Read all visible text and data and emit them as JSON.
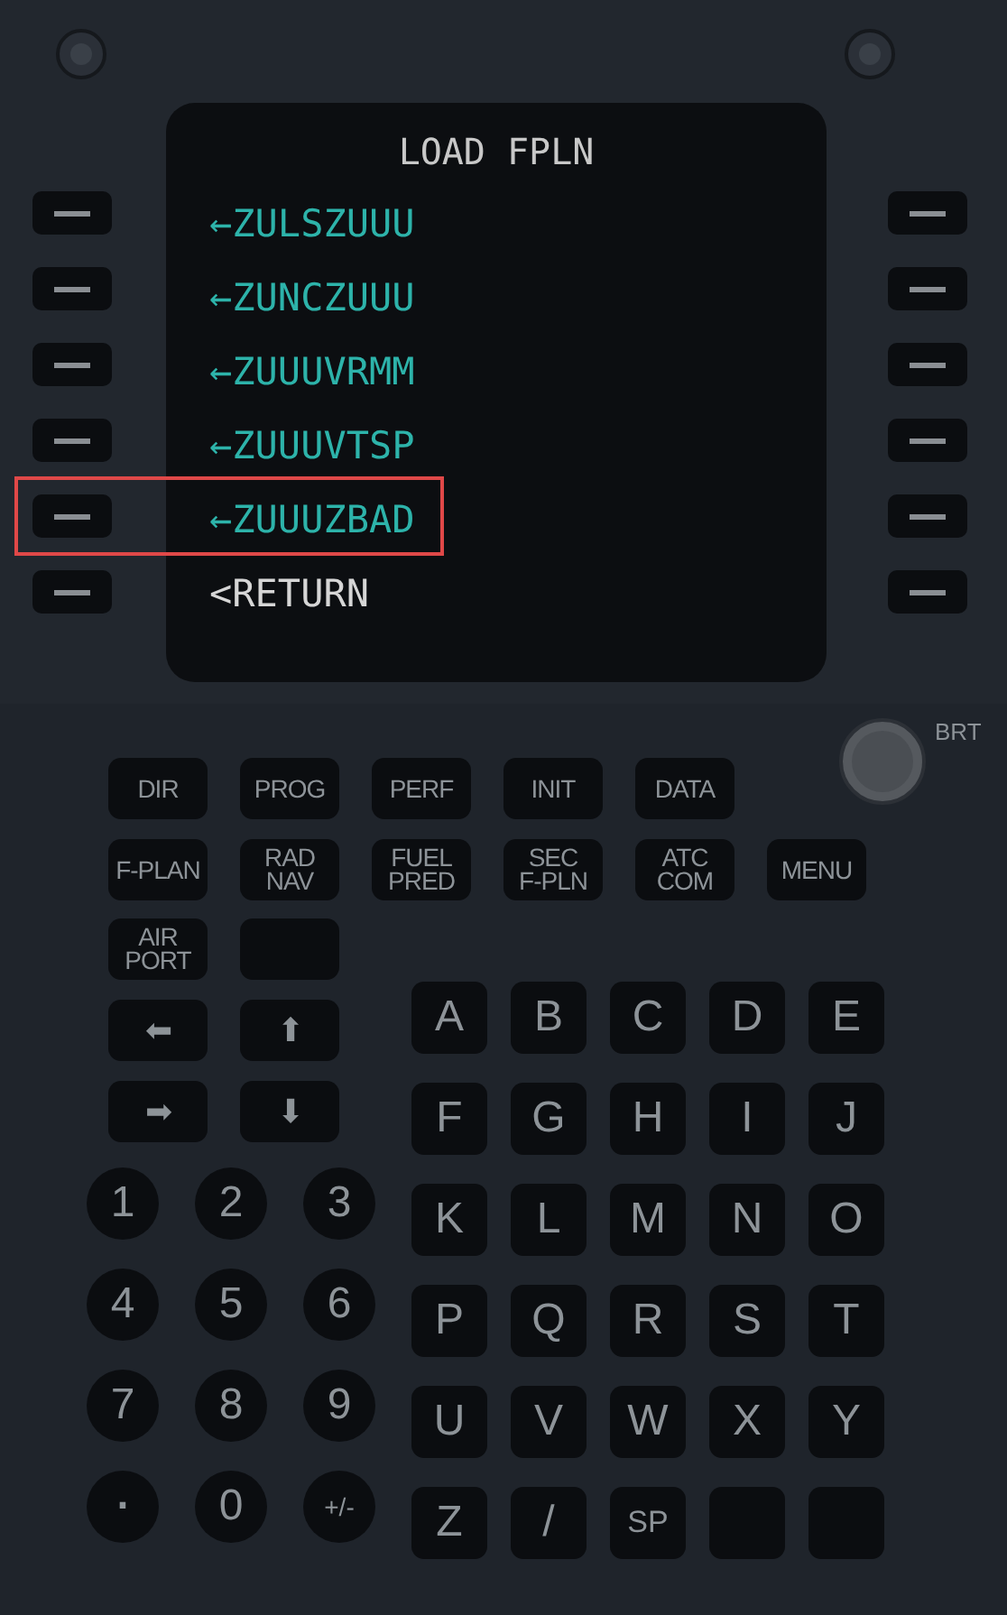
{
  "screen": {
    "title": "LOAD FPLN",
    "lines": [
      {
        "text": "←ZULSZUUU",
        "color": "#2db3aa",
        "highlighted": false
      },
      {
        "text": "←ZUNCZUUU",
        "color": "#2db3aa",
        "highlighted": false
      },
      {
        "text": "←ZUUUVRMM",
        "color": "#2db3aa",
        "highlighted": false
      },
      {
        "text": "←ZUUUVTSP",
        "color": "#2db3aa",
        "highlighted": false
      },
      {
        "text": "←ZUUUZBAD",
        "color": "#2db3aa",
        "highlighted": true
      },
      {
        "text": "<RETURN",
        "color": "#d6d6d6",
        "highlighted": false
      }
    ]
  },
  "brightness": {
    "label": "BRT"
  },
  "function_keys": [
    [
      {
        "lines": [
          "DIR"
        ]
      },
      {
        "lines": [
          "PROG"
        ]
      },
      {
        "lines": [
          "PERF"
        ]
      },
      {
        "lines": [
          "INIT"
        ]
      },
      {
        "lines": [
          "DATA"
        ]
      }
    ],
    [
      {
        "lines": [
          "F-PLAN"
        ]
      },
      {
        "lines": [
          "RAD",
          "NAV"
        ]
      },
      {
        "lines": [
          "FUEL",
          "PRED"
        ]
      },
      {
        "lines": [
          "SEC",
          "F-PLN"
        ]
      },
      {
        "lines": [
          "ATC",
          "COM"
        ]
      },
      {
        "lines": [
          "MENU"
        ]
      }
    ],
    [
      {
        "lines": [
          "AIR",
          "PORT"
        ]
      },
      {
        "kind": "blank"
      }
    ]
  ],
  "arrow_keys": [
    [
      "⬅",
      "⬆"
    ],
    [
      "➡",
      "⬇"
    ]
  ],
  "number_keys": [
    "1",
    "2",
    "3",
    "4",
    "5",
    "6",
    "7",
    "8",
    "9",
    ".",
    "0",
    "+/-"
  ],
  "letter_keys": [
    {
      "label": "A"
    },
    {
      "label": "B"
    },
    {
      "label": "C"
    },
    {
      "label": "D"
    },
    {
      "label": "E"
    },
    {
      "label": "F"
    },
    {
      "label": "G"
    },
    {
      "label": "H"
    },
    {
      "label": "I"
    },
    {
      "label": "J"
    },
    {
      "label": "K"
    },
    {
      "label": "L"
    },
    {
      "label": "M"
    },
    {
      "label": "N"
    },
    {
      "label": "O"
    },
    {
      "label": "P"
    },
    {
      "label": "Q"
    },
    {
      "label": "R"
    },
    {
      "label": "S"
    },
    {
      "label": "T"
    },
    {
      "label": "U"
    },
    {
      "label": "V"
    },
    {
      "label": "W"
    },
    {
      "label": "X"
    },
    {
      "label": "Y"
    },
    {
      "label": "Z"
    },
    {
      "label": "/"
    },
    {
      "label": "SP"
    },
    {
      "kind": "blank"
    },
    {
      "kind": "blank"
    }
  ]
}
